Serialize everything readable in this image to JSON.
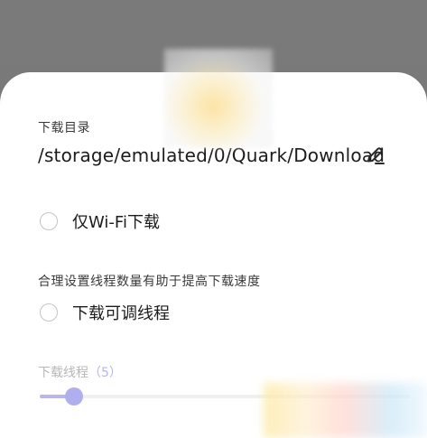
{
  "dialog": {
    "download_dir_label": "下载目录",
    "download_dir_path": "/storage/emulated/0/Quark/Download",
    "wifi_only": {
      "label": "仅Wi-Fi下载",
      "checked": false
    },
    "thread_hint": "合理设置线程数量有助于提高下载速度",
    "adjustable_threads": {
      "label": "下载可调线程",
      "checked": false
    },
    "thread_slider": {
      "label": "下载线程",
      "count_text": "（5）",
      "value": 5
    }
  },
  "icons": {
    "edit": "pencil-icon"
  },
  "colors": {
    "accent": "#b1aeee",
    "overlay": "#7a7a7a",
    "sheet": "#ffffff"
  }
}
